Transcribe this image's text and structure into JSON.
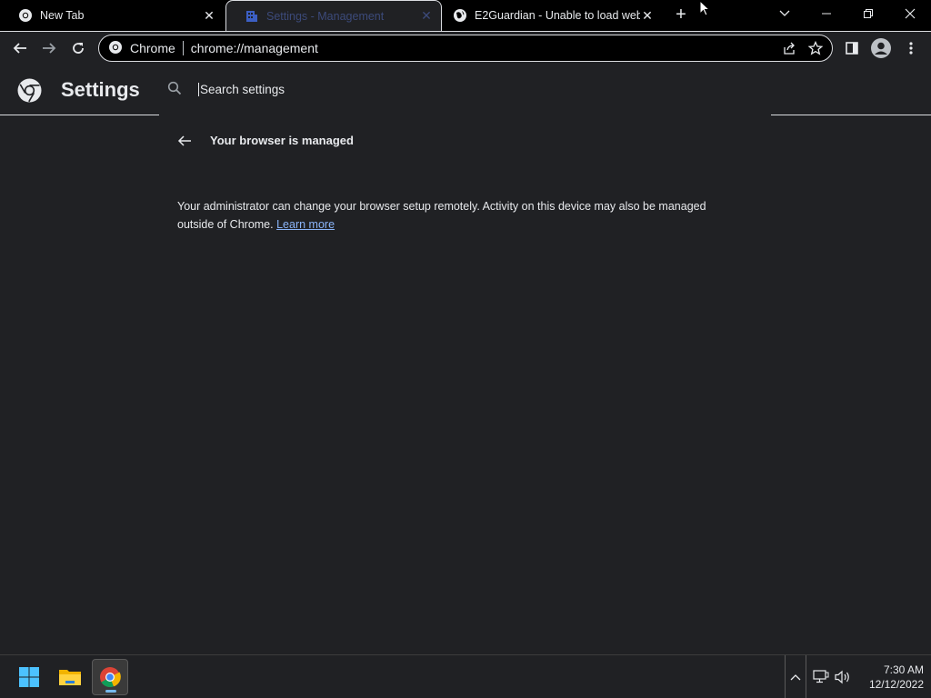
{
  "tabs": [
    {
      "title": "New Tab",
      "icon": "chrome-icon",
      "active": false
    },
    {
      "title": "Settings - Management",
      "icon": "management-icon",
      "active": true
    },
    {
      "title": "E2Guardian - Unable to load web",
      "icon": "globe-icon",
      "active": false
    }
  ],
  "toolbar": {
    "site_chip": "Chrome",
    "url": "chrome://management"
  },
  "settings": {
    "title": "Settings",
    "search_placeholder": "Search settings"
  },
  "page": {
    "heading": "Your browser is managed",
    "info_text": "Your administrator can change your browser setup remotely. Activity on this device may also be managed outside of Chrome.",
    "learn_more": "Learn more"
  },
  "taskbar": {
    "time": "7:30 AM",
    "date": "12/12/2022",
    "apps": [
      "windows-start-icon",
      "file-explorer-icon",
      "chrome-icon"
    ]
  },
  "colors": {
    "background": "#202124",
    "link": "#8ab4f8",
    "text": "#e8eaed"
  }
}
